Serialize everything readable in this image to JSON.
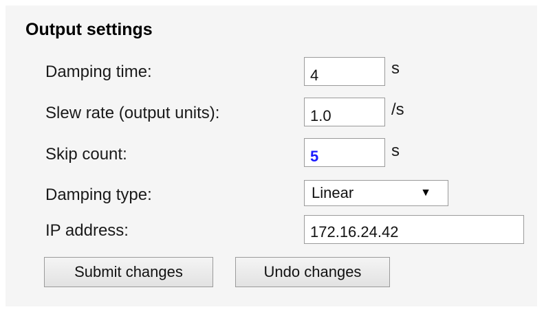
{
  "section": {
    "title": "Output settings"
  },
  "fields": {
    "damping_time": {
      "label": "Damping time:",
      "value": "4",
      "unit": "s"
    },
    "slew_rate": {
      "label": "Slew rate (output units):",
      "value": "1.0",
      "unit": "/s"
    },
    "skip_count": {
      "label": "Skip count:",
      "value": "5",
      "unit": "s"
    },
    "damping_type": {
      "label": "Damping type:",
      "value": "Linear"
    },
    "ip_address": {
      "label": "IP address:",
      "value": "172.16.24.42"
    }
  },
  "buttons": {
    "submit": "Submit changes",
    "undo": "Undo changes"
  },
  "icons": {
    "dropdown": "dropdown-arrow-icon"
  }
}
